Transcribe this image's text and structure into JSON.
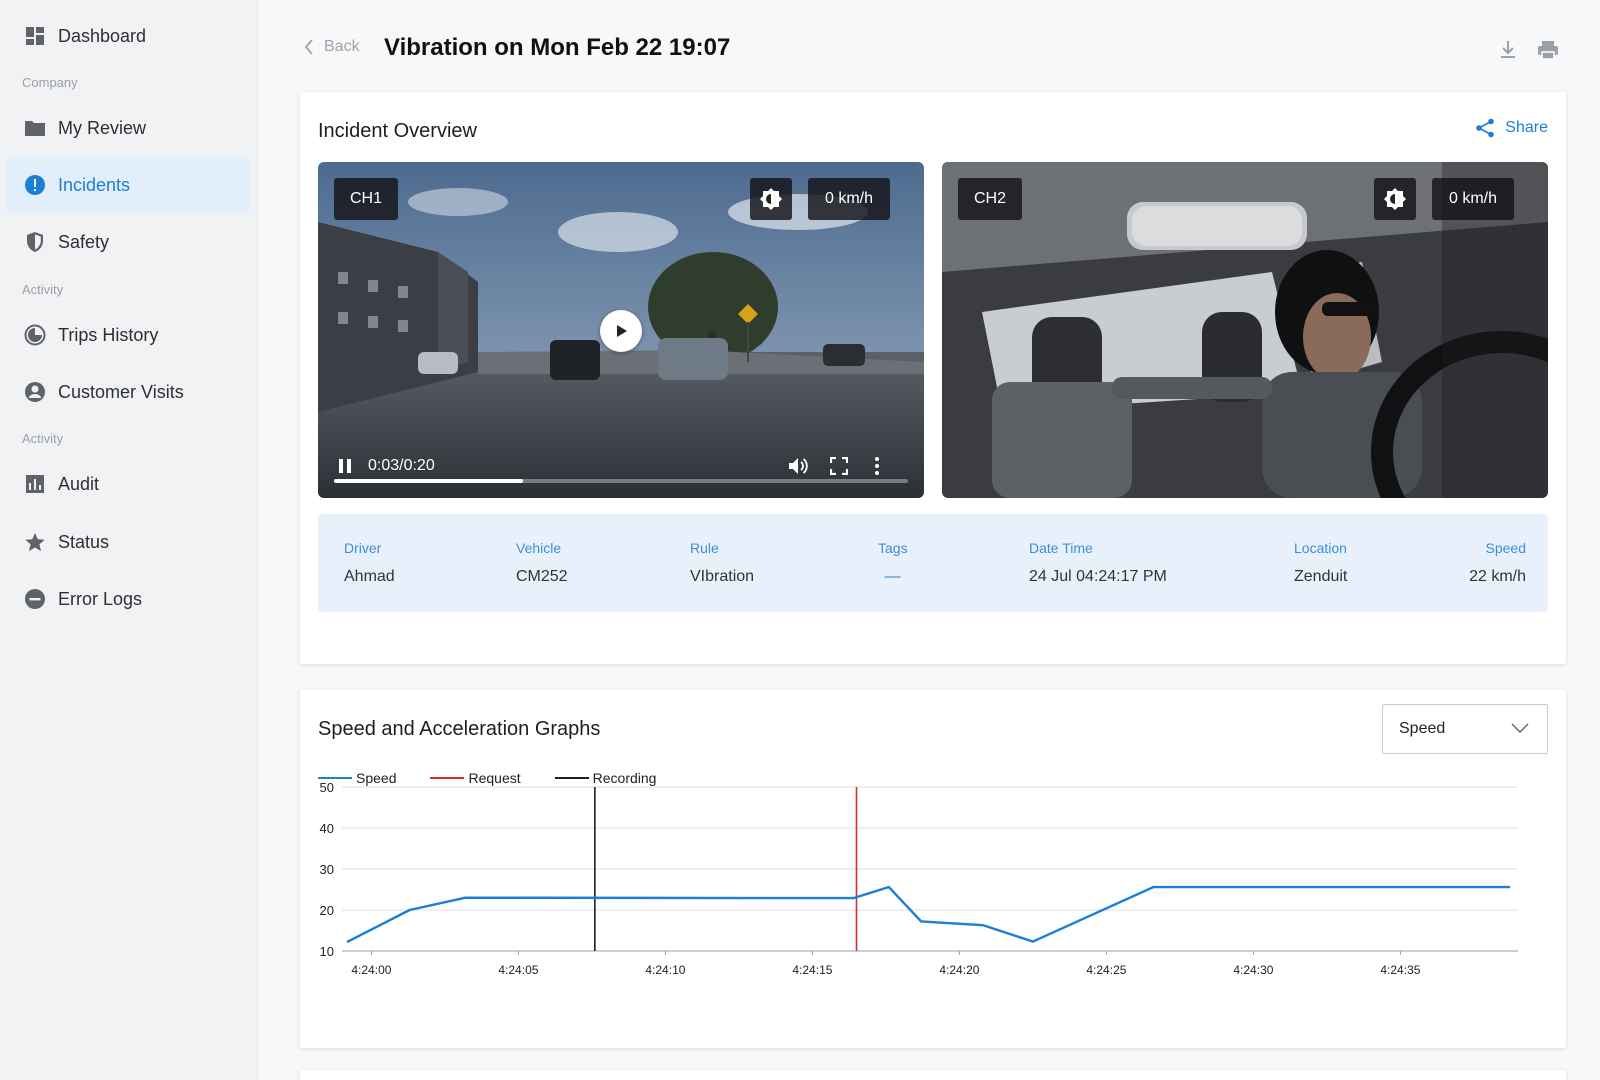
{
  "sidebar": {
    "items": [
      {
        "label": "Dashboard",
        "icon": "dashboard-icon"
      },
      {
        "label": "My Review",
        "icon": "folder-icon"
      },
      {
        "label": "Incidents",
        "icon": "alert-icon"
      },
      {
        "label": "Safety",
        "icon": "shield-icon"
      },
      {
        "label": "Trips History",
        "icon": "history-icon"
      },
      {
        "label": "Customer Visits",
        "icon": "person-icon"
      },
      {
        "label": "Audit",
        "icon": "bar-chart-icon"
      },
      {
        "label": "Status",
        "icon": "star-icon"
      },
      {
        "label": "Error Logs",
        "icon": "minus-circle-icon"
      }
    ],
    "sections": [
      "Company",
      "Activity",
      "Activity"
    ],
    "active_item": "Incidents"
  },
  "header": {
    "back_label": "Back",
    "title": "Vibration on Mon Feb 22 19:07"
  },
  "overview": {
    "title": "Incident Overview",
    "share_label": "Share",
    "videos": [
      {
        "channel": "CH1",
        "speed": "0 km/h",
        "time": "0:03/0:20",
        "progress": 0.33
      },
      {
        "channel": "CH2",
        "speed": "0 km/h"
      }
    ],
    "details": [
      {
        "key": "Driver",
        "value": "Ahmad"
      },
      {
        "key": "Vehicle",
        "value": "CM252"
      },
      {
        "key": "Rule",
        "value": "VIbration"
      },
      {
        "key": "Tags",
        "value": "—"
      },
      {
        "key": "Date Time",
        "value": "24 Jul 04:24:17 PM"
      },
      {
        "key": "Location",
        "value": "Zenduit"
      },
      {
        "key": "Speed",
        "value": "22 km/h"
      }
    ]
  },
  "graphs": {
    "title": "Speed and Acceleration Graphs",
    "select_value": "Speed"
  },
  "colors": {
    "accent": "#1a7fd6",
    "speed": "#1a7fd6",
    "request": "#d32f2f",
    "recording": "#1b1f23"
  },
  "chart_data": {
    "type": "line",
    "series": [
      {
        "name": "Speed",
        "x": [
          "4:23:59.2",
          "4:24:01.3",
          "4:24:03.2",
          "4:24:16.4",
          "4:24:17.6",
          "4:24:18.7",
          "4:24:20.8",
          "4:24:22.5",
          "4:24:26.6",
          "4:24:38.7"
        ],
        "values": [
          12.3,
          20,
          23,
          22.9,
          25.6,
          17.2,
          16.3,
          12.3,
          25.6,
          25.6
        ]
      }
    ],
    "legend": [
      "Speed",
      "Request",
      "Recording"
    ],
    "markers": [
      {
        "name": "Recording",
        "x": "4:24:07.6"
      },
      {
        "name": "Request",
        "x": "4:24:16.5"
      }
    ],
    "x_ticks": [
      "4:24:00",
      "4:24:05",
      "4:24:10",
      "4:24:15",
      "4:24:20",
      "4:24:25",
      "4:24:30",
      "4:24:35"
    ],
    "y_ticks": [
      10,
      20,
      30,
      40,
      50
    ],
    "ylim": [
      10,
      50
    ],
    "xlim": [
      "4:23:59",
      "4:24:39"
    ],
    "grid": true,
    "legend_position": "top-left"
  }
}
